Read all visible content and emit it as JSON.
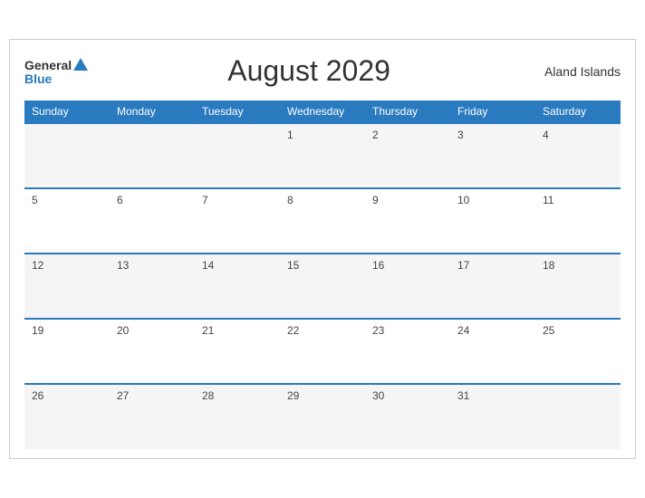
{
  "header": {
    "logo": {
      "general": "General",
      "blue": "Blue",
      "triangle": true
    },
    "title": "August 2029",
    "region": "Aland Islands"
  },
  "calendar": {
    "days_of_week": [
      "Sunday",
      "Monday",
      "Tuesday",
      "Wednesday",
      "Thursday",
      "Friday",
      "Saturday"
    ],
    "weeks": [
      [
        "",
        "",
        "",
        "1",
        "2",
        "3",
        "4"
      ],
      [
        "5",
        "6",
        "7",
        "8",
        "9",
        "10",
        "11"
      ],
      [
        "12",
        "13",
        "14",
        "15",
        "16",
        "17",
        "18"
      ],
      [
        "19",
        "20",
        "21",
        "22",
        "23",
        "24",
        "25"
      ],
      [
        "26",
        "27",
        "28",
        "29",
        "30",
        "31",
        ""
      ]
    ]
  }
}
